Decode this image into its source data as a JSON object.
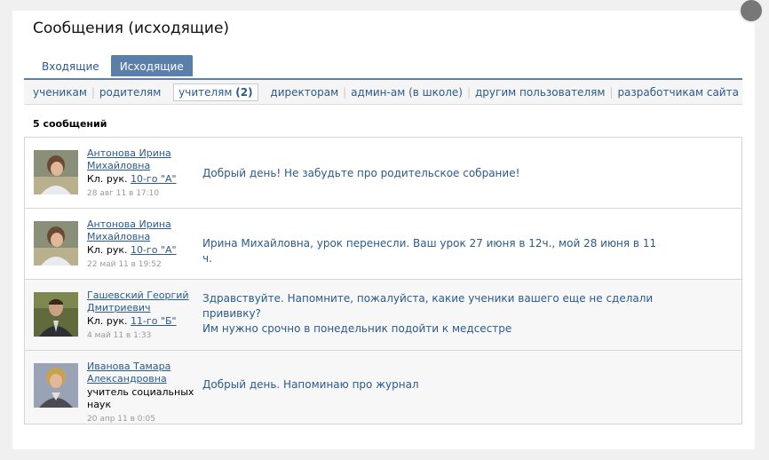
{
  "header": {
    "title": "Сообщения (исходящие)"
  },
  "tabs": [
    {
      "label": "Входящие"
    },
    {
      "label": "Исходящие"
    }
  ],
  "filters": {
    "students": "ученикам",
    "parents": "родителям",
    "teachers_label": "учителям",
    "teachers_count": "(2)",
    "directors": "директорам",
    "admins": "админ-ам (в школе)",
    "others": "другим пользователям",
    "developers": "разработчикам сайта"
  },
  "summary": {
    "count": "5 сообщений"
  },
  "messages": [
    {
      "name_line1": "Антонова Ирина",
      "name_line2": "Михайловна",
      "role_prefix": "Кл. рук.",
      "class_link": "10-го \"А\"",
      "date": "28 авг 11 в 17:10",
      "text": "Добрый день! Не забудьте про родительское собрание!"
    },
    {
      "name_line1": "Антонова Ирина",
      "name_line2": "Михайловна",
      "role_prefix": "Кл. рук.",
      "class_link": "10-го \"А\"",
      "date": "22 май 11 в 19:52",
      "text": "Ирина Михайловна, урок перенесли. Ваш урок 27 июня в 12ч., мой 28 июня в 11 ч."
    },
    {
      "name_line1": "Гашевский Георгий",
      "name_line2": "Дмитриевич",
      "role_prefix": "Кл. рук.",
      "class_link": "11-го \"Б\"",
      "date": "4 май 11 в 1:33",
      "text_line1": "Здравствуйте. Напомните, пожалуйста, какие ученики вашего еще не сделали",
      "text_line2": "прививку?",
      "text_line3": "Им нужно срочно в понедельник подойти к медсестре"
    },
    {
      "name_line1": "Иванова Тамара",
      "name_line2": "Александровна",
      "role_line1": "учитель социальных",
      "role_line2": "наук",
      "date": "20 апр 11 в 0:05",
      "text": "Добрый день. Напоминаю про журнал"
    }
  ]
}
